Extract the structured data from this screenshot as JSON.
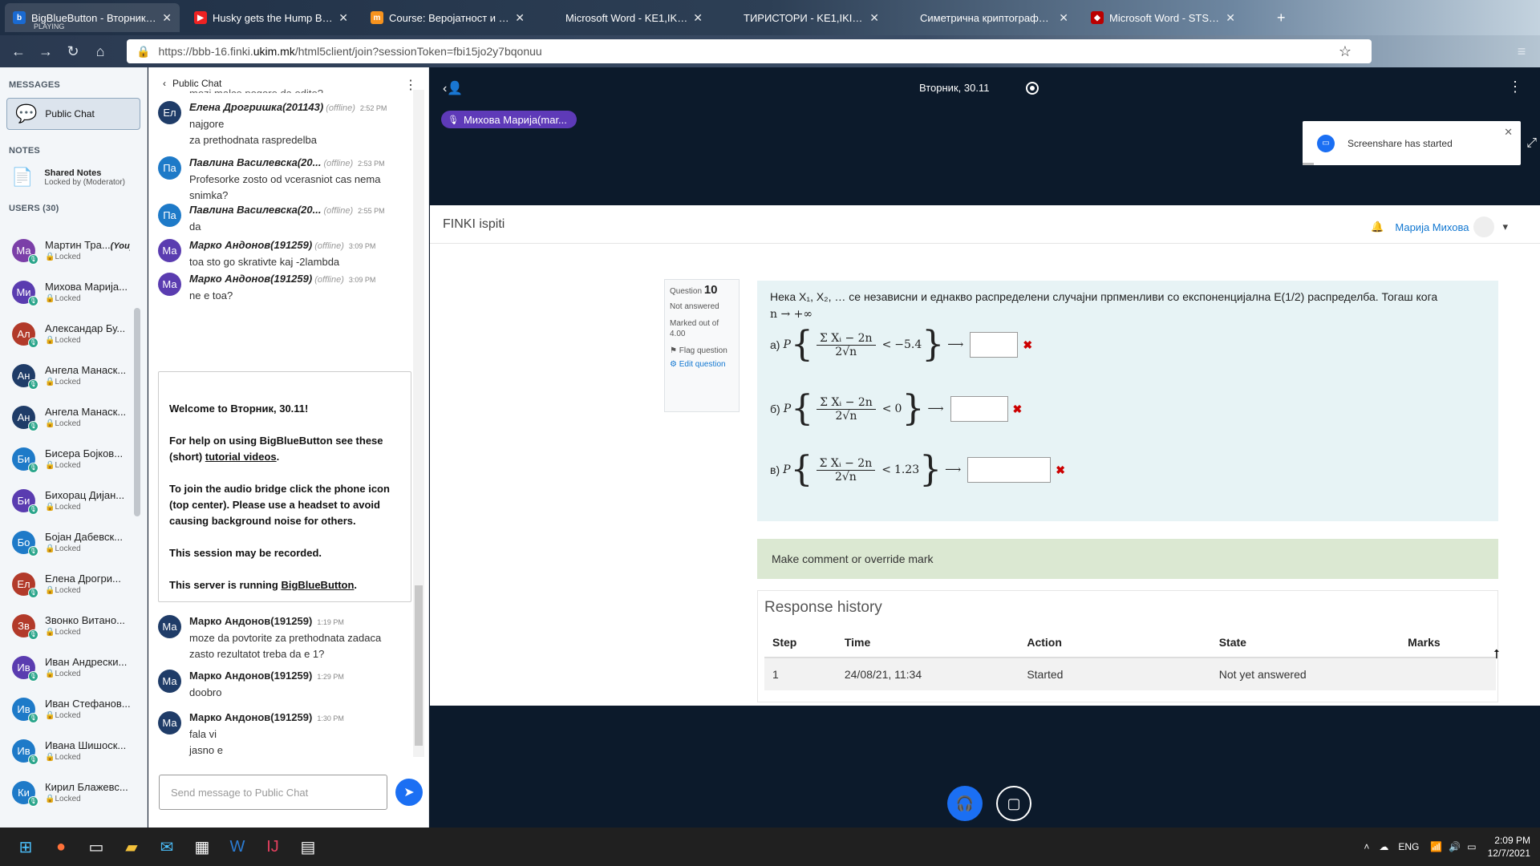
{
  "tabs": [
    {
      "title": "BigBlueButton - Вторник, 30.11",
      "sub": "PLAYING",
      "fav": "b",
      "favbg": "#1a6ad1"
    },
    {
      "title": "Husky gets the Hump Big Time",
      "fav": "▶",
      "favbg": "#e22"
    },
    {
      "title": "Course: Веројатност и статистика",
      "fav": "m",
      "favbg": "#f7931e"
    },
    {
      "title": "Microsoft Word - KE1,IKI,AV,06 Ogra",
      "fav": "",
      "favbg": "transparent"
    },
    {
      "title": "ТИРИСТОРИ - KE1,IKI,AV,07 Nasoc",
      "fav": "",
      "favbg": "transparent"
    },
    {
      "title": "Симетрична криптографија - PK",
      "fav": "",
      "favbg": "transparent"
    },
    {
      "title": "Microsoft Word - STS.doc - sts",
      "fav": "◆",
      "favbg": "#b00"
    }
  ],
  "url": {
    "prefix": "https://bbb-16.finki.",
    "host": "ukim.mk",
    "path": "/html5client/join?sessionToken=fbi15jo2y7bqonuu"
  },
  "left": {
    "messages_label": "MESSAGES",
    "public_chat": "Public Chat",
    "notes_label": "NOTES",
    "shared_notes": "Shared Notes",
    "shared_notes_sub": "Locked by (Moderator)",
    "users_label": "USERS (30)"
  },
  "users": [
    {
      "initials": "Ма",
      "name": "Мартин Тра...",
      "you": "(You)",
      "color": "#7b3fa8"
    },
    {
      "initials": "Ми",
      "name": "Михова Марија...",
      "color": "#5a3cb0"
    },
    {
      "initials": "Ал",
      "name": "Александар Бу...",
      "color": "#b23a2a"
    },
    {
      "initials": "Ан",
      "name": "Ангела Манаск...",
      "color": "#1f3c68"
    },
    {
      "initials": "Ан",
      "name": "Ангела Манаск...",
      "color": "#1f3c68"
    },
    {
      "initials": "Би",
      "name": "Бисера Бојков...",
      "color": "#1e7ac8"
    },
    {
      "initials": "Би",
      "name": "Бихорац Дијан...",
      "color": "#5a3cb0"
    },
    {
      "initials": "Бо",
      "name": "Бојан Дабевск...",
      "color": "#1e7ac8"
    },
    {
      "initials": "Ел",
      "name": "Елена Дрогри...",
      "color": "#b23a2a"
    },
    {
      "initials": "Зв",
      "name": "Звонко Витано...",
      "color": "#b23a2a"
    },
    {
      "initials": "Ив",
      "name": "Иван Андрески...",
      "color": "#5a3cb0"
    },
    {
      "initials": "Ив",
      "name": "Иван Стефанов...",
      "color": "#1e7ac8"
    },
    {
      "initials": "Ив",
      "name": "Ивана Шишоск...",
      "color": "#1e7ac8"
    },
    {
      "initials": "Ки",
      "name": "Кирил Блажевс...",
      "color": "#1e7ac8"
    }
  ],
  "locked_label": "Locked",
  "chat": {
    "header": "Public Chat",
    "top_cut": "mozi malce pogore da odite?",
    "messages": [
      {
        "initials": "Ел",
        "color": "#1f3c68",
        "who": "Елена Дрогришка(201143)",
        "offline": "(offline)",
        "time": "2:52 PM",
        "lines": [
          "najgore",
          "za prethodnata raspredelba"
        ]
      },
      {
        "initials": "Па",
        "color": "#1e7ac8",
        "who": "Павлина Василевска(20...",
        "offline": "(offline)",
        "time": "2:53 PM",
        "lines": [
          "Profesorke zosto od vcerasniot cas nema snimka?"
        ]
      },
      {
        "initials": "Па",
        "color": "#1e7ac8",
        "who": "Павлина Василевска(20...",
        "offline": "(offline)",
        "time": "2:55 PM",
        "lines": [
          "da"
        ]
      },
      {
        "initials": "Ма",
        "color": "#5a3cb0",
        "who": "Марко Андонов(191259)",
        "offline": "(offline)",
        "time": "3:09 PM",
        "lines": [
          "toa sto go skrativte kaj -2lambda"
        ]
      },
      {
        "initials": "Ма",
        "color": "#5a3cb0",
        "who": "Марко Андонов(191259)",
        "offline": "(offline)",
        "time": "3:09 PM",
        "lines": [
          "ne e toa?"
        ]
      }
    ],
    "welcome": {
      "l1a": "Welcome to ",
      "l1b": "Вторник, 30.11",
      "l1c": "!",
      "l2a": "For help on using BigBlueButton see these (short) ",
      "l2b": "tutorial videos",
      "l2c": ".",
      "l3": "To join the audio bridge click the phone icon (top center). Please use a headset to avoid causing background noise for others.",
      "l4": "This session may be recorded.",
      "l5a": "This server is running ",
      "l5b": "BigBlueButton",
      "l5c": "."
    },
    "later": [
      {
        "initials": "Ма",
        "color": "#1f3c68",
        "who": "Марко Андонов(191259)",
        "time": "1:19 PM",
        "lines": [
          "moze da povtorite za prethodnata zadaca zasto rezultatot treba da e 1?"
        ]
      },
      {
        "initials": "Ма",
        "color": "#1f3c68",
        "who": "Марко Андонов(191259)",
        "time": "1:29 PM",
        "lines": [
          "doobro"
        ]
      },
      {
        "initials": "Ма",
        "color": "#1f3c68",
        "who": "Марко Андонов(191259)",
        "time": "1:30 PM",
        "lines": [
          "fala vi",
          "jasno e"
        ]
      }
    ],
    "input_placeholder": "Send message to Public Chat"
  },
  "presentation": {
    "title": "Вторник, 30.11",
    "talker": "Михова Марија(mar...",
    "toast": "Screenshare has started"
  },
  "screen": {
    "site": "FINKI ispiti",
    "user": "Марија Михова",
    "q_label": "Question",
    "q_num": "10",
    "q_status": "Not answered",
    "q_marked": "Marked out of 4.00",
    "q_flag": "Flag question",
    "q_edit": "Edit question",
    "q_text": "Нека X₁, X₂, … се независни и еднакво распределени случајни прпменливи со експоненцијална E(1/2) распределба. Тогаш кога",
    "q_text2": "n → +∞",
    "parts": [
      {
        "label": "а)",
        "rhs": "−5.4"
      },
      {
        "label": "б)",
        "rhs": "0"
      },
      {
        "label": "в)",
        "rhs": "1.23"
      }
    ],
    "comment": "Make comment or override mark",
    "rh_title": "Response history",
    "rh_cols": [
      "Step",
      "Time",
      "Action",
      "State",
      "Marks"
    ],
    "rh_row": [
      "1",
      "24/08/21, 11:34",
      "Started",
      "Not yet answered",
      ""
    ]
  },
  "tray": {
    "lang": "ENG",
    "time": "2:09 PM",
    "date": "12/7/2021"
  }
}
